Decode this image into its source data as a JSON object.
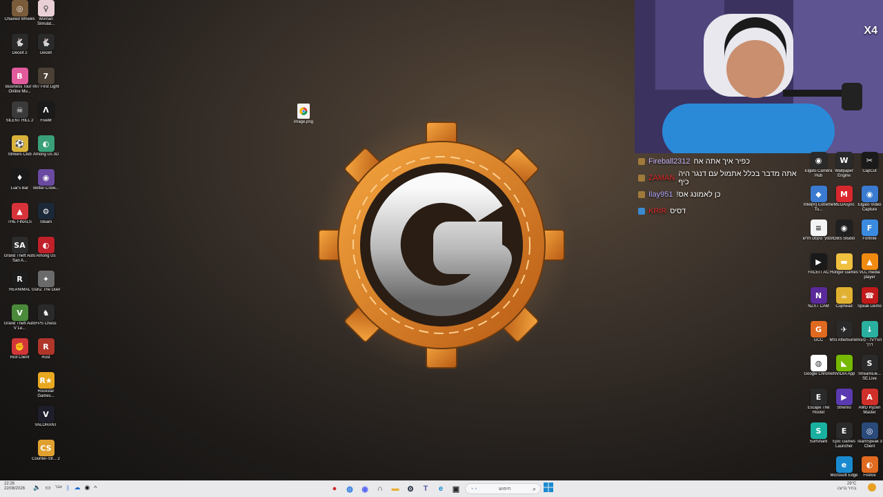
{
  "desktop": {
    "left_col_1": [
      {
        "label": "Chained Wheels",
        "icon": "chained-wheels-icon",
        "color": "#7a5b3a",
        "glyph": "◎"
      },
      {
        "label": "Decelt 2",
        "icon": "rabbit-icon",
        "color": "#2a2a2a",
        "glyph": "🐇"
      },
      {
        "label": "Business Tour - Online Mu...",
        "icon": "business-tour-icon",
        "color": "#e05a9c",
        "glyph": "B"
      },
      {
        "label": "SILENT HILL 2",
        "icon": "silent-hill-icon",
        "color": "#3a3a3a",
        "glyph": "☠"
      },
      {
        "label": "Strikers Club",
        "icon": "strikers-club-icon",
        "color": "#d9b23a",
        "glyph": "⚽"
      },
      {
        "label": "Liar's Bar",
        "icon": "liars-bar-icon",
        "color": "#1a1a1a",
        "glyph": "♦"
      },
      {
        "label": "THE FINALS",
        "icon": "the-finals-icon",
        "color": "#d8323a",
        "glyph": "▲"
      },
      {
        "label": "Grand Theft Auto San A...",
        "icon": "gta-sa-icon",
        "color": "#2b2b2b",
        "glyph": "SA"
      },
      {
        "label": "REANIMAL",
        "icon": "reanimal-icon",
        "color": "#1c1c1c",
        "glyph": "R"
      },
      {
        "label": "Grand Theft Auto V Le...",
        "icon": "gta-v-icon",
        "color": "#4a8a3a",
        "glyph": "V"
      },
      {
        "label": "Riot Client",
        "icon": "riot-client-icon",
        "color": "#d13639",
        "glyph": "✊"
      }
    ],
    "left_col_2": [
      {
        "label": "Woman Simulat...",
        "icon": "woman-simulator-icon",
        "color": "#e9d0d6",
        "glyph": "♀"
      },
      {
        "label": "Decelt",
        "icon": "rabbit-icon",
        "color": "#2a2a2a",
        "glyph": "🐇"
      },
      {
        "label": "007 First Light",
        "icon": "007-icon",
        "color": "#4a4036",
        "glyph": "7"
      },
      {
        "label": "FiveM",
        "icon": "fivem-icon",
        "color": "#1a1a1a",
        "glyph": "Λ"
      },
      {
        "label": "Among Us 3D",
        "icon": "among-us-3d-icon",
        "color": "#3aa07a",
        "glyph": "◐"
      },
      {
        "label": "Better-Crew...",
        "icon": "better-crew-icon",
        "color": "#6a4aa0",
        "glyph": "◉"
      },
      {
        "label": "Steam",
        "icon": "steam-icon",
        "color": "#1b2838",
        "glyph": "⚙"
      },
      {
        "label": "Among Us",
        "icon": "among-us-icon",
        "color": "#c0202a",
        "glyph": "◐"
      },
      {
        "label": "GunZ The Duel",
        "icon": "gunz-icon",
        "color": "#6a6a6a",
        "glyph": "✦"
      },
      {
        "label": "FPS Chess",
        "icon": "fps-chess-icon",
        "color": "#2a2a2a",
        "glyph": "♞"
      },
      {
        "label": "Rust",
        "icon": "rust-icon",
        "color": "#b0362a",
        "glyph": "R"
      },
      {
        "label": "Rockstar Games...",
        "icon": "rockstar-icon",
        "color": "#e8a820",
        "glyph": "R★"
      },
      {
        "label": "VALORANT",
        "icon": "valorant-icon",
        "color": "#1e1e2a",
        "glyph": "V"
      },
      {
        "label": "Counter-Str... 2",
        "icon": "counter-strike-icon",
        "color": "#e0a030",
        "glyph": "CS"
      }
    ],
    "right_col_1": [
      {
        "label": "Elgato Camera Hub",
        "icon": "elgato-camera-icon",
        "color": "#2a2a2a",
        "glyph": "◉"
      },
      {
        "label": "Intel(R) Extreme Tu...",
        "icon": "intel-xtu-icon",
        "color": "#3a7ad0",
        "glyph": "◆"
      },
      {
        "label": "מסמך טקסט חדש",
        "icon": "text-document-icon",
        "color": "#f4f4f4",
        "glyph": "≡"
      },
      {
        "label": "FACEIT AC",
        "icon": "faceit-icon",
        "color": "#1a1a1a",
        "glyph": "▶"
      },
      {
        "label": "NZXT CAM",
        "icon": "nzxt-cam-icon",
        "color": "#5a2a9a",
        "glyph": "N"
      },
      {
        "label": "GCC",
        "icon": "gcc-icon",
        "color": "#e06a20",
        "glyph": "G"
      },
      {
        "label": "Google Chrome",
        "icon": "chrome-icon",
        "color": "#ffffff",
        "glyph": "◍"
      },
      {
        "label": "Escape The Hostel",
        "icon": "escape-hostel-icon",
        "color": "#2a2a2a",
        "glyph": "E"
      },
      {
        "label": "Surfshark",
        "icon": "surfshark-icon",
        "color": "#1ab0a0",
        "glyph": "S"
      }
    ],
    "right_col_2": [
      {
        "label": "Wallpaper Engine",
        "icon": "wallpaper-engine-icon",
        "color": "#2a2a2a",
        "glyph": "W"
      },
      {
        "label": "MEGAsync",
        "icon": "megasync-icon",
        "color": "#d9272e",
        "glyph": "M"
      },
      {
        "label": "OBS Studio",
        "icon": "obs-icon",
        "color": "#202020",
        "glyph": "◉"
      },
      {
        "label": "Hunger Games",
        "icon": "folder-icon",
        "color": "#f0c040",
        "glyph": "▬"
      },
      {
        "label": "Cuphead",
        "icon": "cuphead-icon",
        "color": "#e0b030",
        "glyph": "☕"
      },
      {
        "label": "MSI Afterburner",
        "icon": "msi-afterburner-icon",
        "color": "#2a2a2a",
        "glyph": "✈"
      },
      {
        "label": "NVIDIA App",
        "icon": "nvidia-icon",
        "color": "#76b900",
        "glyph": "◣"
      },
      {
        "label": "Stremio",
        "icon": "stremio-icon",
        "color": "#5a3ab0",
        "glyph": "▶"
      },
      {
        "label": "Epic Games Launcher",
        "icon": "epic-games-icon",
        "color": "#2a2a2a",
        "glyph": "E"
      },
      {
        "label": "Microsoft Edge",
        "icon": "edge-icon",
        "color": "#1a8ad0",
        "glyph": "e"
      }
    ],
    "right_col_3": [
      {
        "label": "CapCut",
        "icon": "capcut-icon",
        "color": "#1a1a1a",
        "glyph": "✂"
      },
      {
        "label": "Elgato Video Capture",
        "icon": "elgato-video-icon",
        "color": "#3a7ad0",
        "glyph": "◉"
      },
      {
        "label": "Fortnite",
        "icon": "fortnite-icon",
        "color": "#3a8ae0",
        "glyph": "F"
      },
      {
        "label": "VLC media player",
        "icon": "vlc-icon",
        "color": "#f08a10",
        "glyph": "▲"
      },
      {
        "label": "Speak Demo",
        "icon": "speak-demo-icon",
        "color": "#c01a1a",
        "glyph": "☎"
      },
      {
        "label": "הורדות - קיצור דרך",
        "icon": "downloads-icon",
        "color": "#2ab0a0",
        "glyph": "↓"
      },
      {
        "label": "StreamEle... SE.Live",
        "icon": "streamelements-icon",
        "color": "#2a2a2a",
        "glyph": "S"
      },
      {
        "label": "AMD Ryzen Master",
        "icon": "amd-ryzen-icon",
        "color": "#d0302a",
        "glyph": "A"
      },
      {
        "label": "TeamSpeak 3 Client",
        "icon": "teamspeak-icon",
        "color": "#2a4a7a",
        "glyph": "◎"
      },
      {
        "label": "Firefox",
        "icon": "firefox-icon",
        "color": "#e06a20",
        "glyph": "◐"
      }
    ],
    "file": {
      "label": "image.png",
      "icon": "chrome-file-icon"
    }
  },
  "chat": [
    {
      "user": "Fireball2312",
      "message": "כפיר איך אתה אח",
      "user_color": "#c8b8ff",
      "badge_color": "#a07a3a"
    },
    {
      "user": "ZAMAN",
      "message": "אתה מדבר בכלל אתמול עם דנגר היה כיף",
      "user_color": "#e02a2a",
      "badge_color": "#a07a3a"
    },
    {
      "user": "Ilay951",
      "message": "!כן לאמונג אס",
      "user_color": "#b0a8ff",
      "badge_color": "#a07a3a"
    },
    {
      "user": "KRIR",
      "message": "דסיס",
      "user_color": "#e02a2a",
      "badge_color": "#3a8ad0"
    }
  ],
  "webcam": {
    "overlay_badge": "X4"
  },
  "taskbar": {
    "time": "22:26",
    "date": "22/08/2026",
    "language": "עבר",
    "search_placeholder": "חיפוש",
    "weather_temp": "29°C",
    "weather_desc": "בהיר ברובו",
    "pinned": [
      {
        "name": "app-red-icon",
        "color": "#d02a2a",
        "glyph": "●"
      },
      {
        "name": "chrome-icon",
        "color": "#2a7ae0",
        "glyph": "◍"
      },
      {
        "name": "discord-icon",
        "color": "#5865f2",
        "glyph": "◉"
      },
      {
        "name": "headset-icon",
        "color": "#3a3a3a",
        "glyph": "∩"
      },
      {
        "name": "file-explorer-icon",
        "color": "#e8b030",
        "glyph": "▬"
      },
      {
        "name": "steam-icon",
        "color": "#1b2838",
        "glyph": "⚙"
      },
      {
        "name": "teams-icon",
        "color": "#5a5ab0",
        "glyph": "T"
      },
      {
        "name": "edge-icon",
        "color": "#1a8ad0",
        "glyph": "e"
      },
      {
        "name": "task-view-icon",
        "color": "#2a2a2a",
        "glyph": "▣"
      }
    ]
  },
  "colors": {
    "taskbar_bg": "#e9e9ec",
    "accent_orange": "#e88a20"
  }
}
